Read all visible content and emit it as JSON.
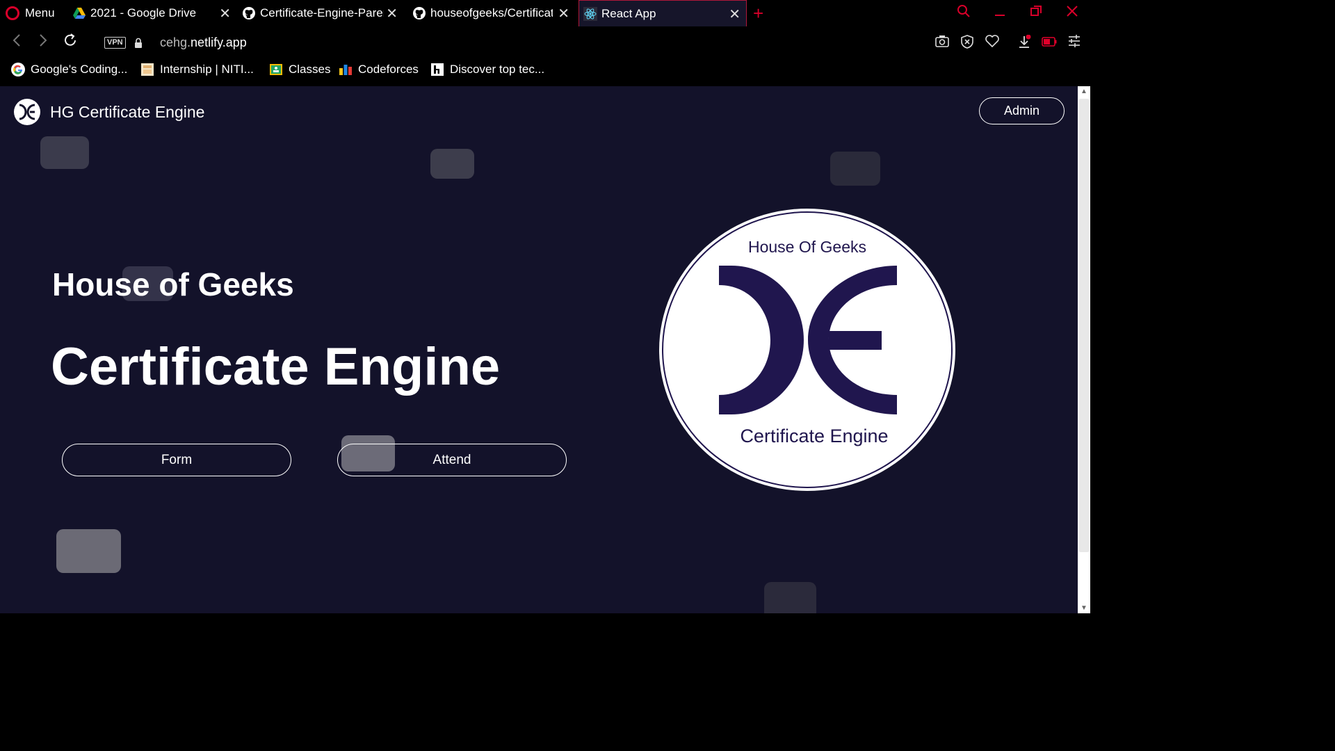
{
  "browser": {
    "menu_label": "Menu",
    "tabs": [
      {
        "title": "2021 - Google Drive",
        "icon": "google-drive-icon"
      },
      {
        "title": "Certificate-Engine-Parent",
        "icon": "github-icon"
      },
      {
        "title": "houseofgeeks/Certificate",
        "icon": "github-icon"
      },
      {
        "title": "React App",
        "icon": "react-icon",
        "active": true
      }
    ],
    "new_tab_symbol": "+",
    "vpn_label": "VPN",
    "url_prefix": "cehg.",
    "url_domain": "netlify.app",
    "bookmarks": [
      {
        "label": "Google's Coding...",
        "icon": "google-icon"
      },
      {
        "label": "Internship | NITI...",
        "icon": "bookmark-image-icon"
      },
      {
        "label": "Classes",
        "icon": "classroom-icon"
      },
      {
        "label": "Codeforces",
        "icon": "codeforces-icon"
      },
      {
        "label": "Discover top tec...",
        "icon": "hashnode-icon"
      }
    ],
    "accent_color": "#d8002a"
  },
  "page": {
    "background": "#13122a",
    "brand_name": "HG Certificate Engine",
    "admin_label": "Admin",
    "headline_small": "House of Geeks",
    "headline_big": "Certificate Engine",
    "form_label": "Form",
    "attend_label": "Attend",
    "logo_top_text": "House Of Geeks",
    "logo_bottom_text": "Certificate Engine",
    "logo_color": "#20164e"
  }
}
